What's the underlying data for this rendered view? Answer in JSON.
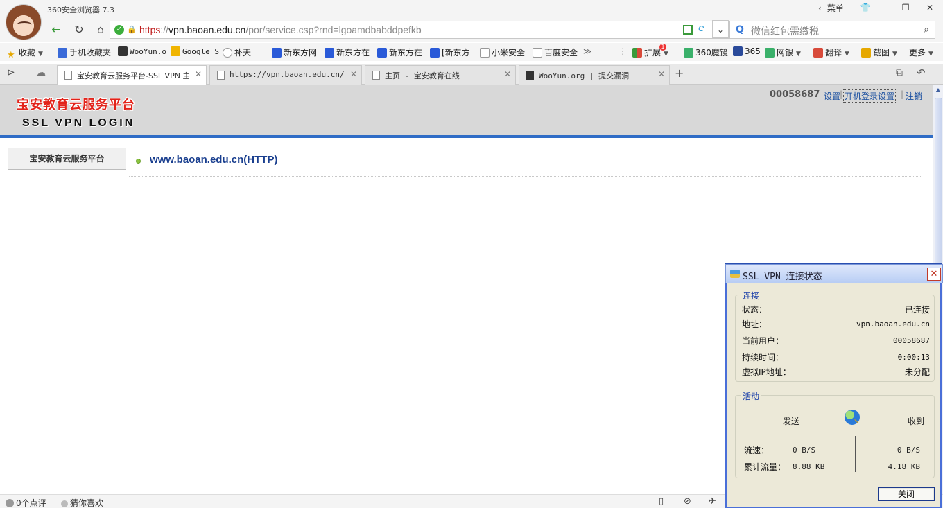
{
  "browser": {
    "app_title": "360安全浏览器 7.3",
    "menu_label": "菜单",
    "url": {
      "protocol": "https",
      "separator": "://",
      "host": "vpn.baoan.edu.cn",
      "path": "/por/service.csp?rnd=lgoamdbabddpefkb"
    },
    "search_placeholder": "微信红包需缴税",
    "favorites": [
      {
        "label": "收藏",
        "icon": "star-icon"
      },
      {
        "label": "手机收藏夹",
        "icon": "phone-icon"
      },
      {
        "label": "WooYun.o",
        "icon": "wooyun-icon"
      },
      {
        "label": "Google S",
        "icon": "google-icon"
      },
      {
        "label": "补天 -",
        "icon": "butian-icon"
      },
      {
        "label": "新东方网",
        "icon": "paw-icon"
      },
      {
        "label": "新东方在",
        "icon": "paw-icon"
      },
      {
        "label": "新东方在",
        "icon": "paw-icon"
      },
      {
        "label": "[新东方",
        "icon": "paw-icon"
      },
      {
        "label": "小米安全",
        "icon": "page-icon"
      },
      {
        "label": "百度安全",
        "icon": "page-icon"
      },
      {
        "label": "扩展",
        "icon": "extensions-icon"
      },
      {
        "label": "360魔镜",
        "icon": "mirror-icon"
      },
      {
        "label": "365",
        "icon": "shield-icon"
      },
      {
        "label": "网银",
        "icon": "bank-icon"
      },
      {
        "label": "翻译",
        "icon": "translate-icon"
      },
      {
        "label": "截图",
        "icon": "screenshot-icon"
      },
      {
        "label": "更多",
        "icon": "more-icon"
      }
    ],
    "extension_badge": "1",
    "tabs": [
      {
        "label": "宝安教育云服务平台-SSL VPN 主",
        "active": true
      },
      {
        "label": "https://vpn.baoan.edu.cn/por",
        "active": false
      },
      {
        "label": "主页 - 宝安教育在线",
        "active": false
      },
      {
        "label": "WooYun.org | 提交漏洞",
        "active": false
      }
    ],
    "status": {
      "comments": "0个点评",
      "guess": "猜你喜欢"
    }
  },
  "page": {
    "site_title": "宝安教育云服务平台",
    "subtitle": "SSL VPN LOGIN",
    "user_id": "00058687",
    "settings_link": "设置",
    "startup_link": "开机登录设置",
    "logout_link": "注销",
    "separator": "|",
    "left_tab": "宝安教育云服务平台",
    "resource_link": "www.baoan.edu.cn(HTTP)"
  },
  "vpn_dialog": {
    "title": "SSL VPN 连接状态",
    "connection_group": "连接",
    "rows": [
      {
        "label": "状态：",
        "value": "已连接"
      },
      {
        "label": "地址：",
        "value": "vpn.baoan.edu.cn"
      },
      {
        "label": "当前用户：",
        "value": "00058687"
      },
      {
        "label": "持续时间：",
        "value": "0:00:13"
      },
      {
        "label": "虚拟IP地址：",
        "value": "未分配"
      }
    ],
    "activity_group": "活动",
    "send_label": "发送",
    "receive_label": "收到",
    "speed_label": "流速：",
    "speed_send": "0 B/S",
    "speed_recv": "0 B/S",
    "total_label": "累计流量：",
    "total_send": "8.88 KB",
    "total_recv": "4.18 KB",
    "close_button": "关闭"
  }
}
